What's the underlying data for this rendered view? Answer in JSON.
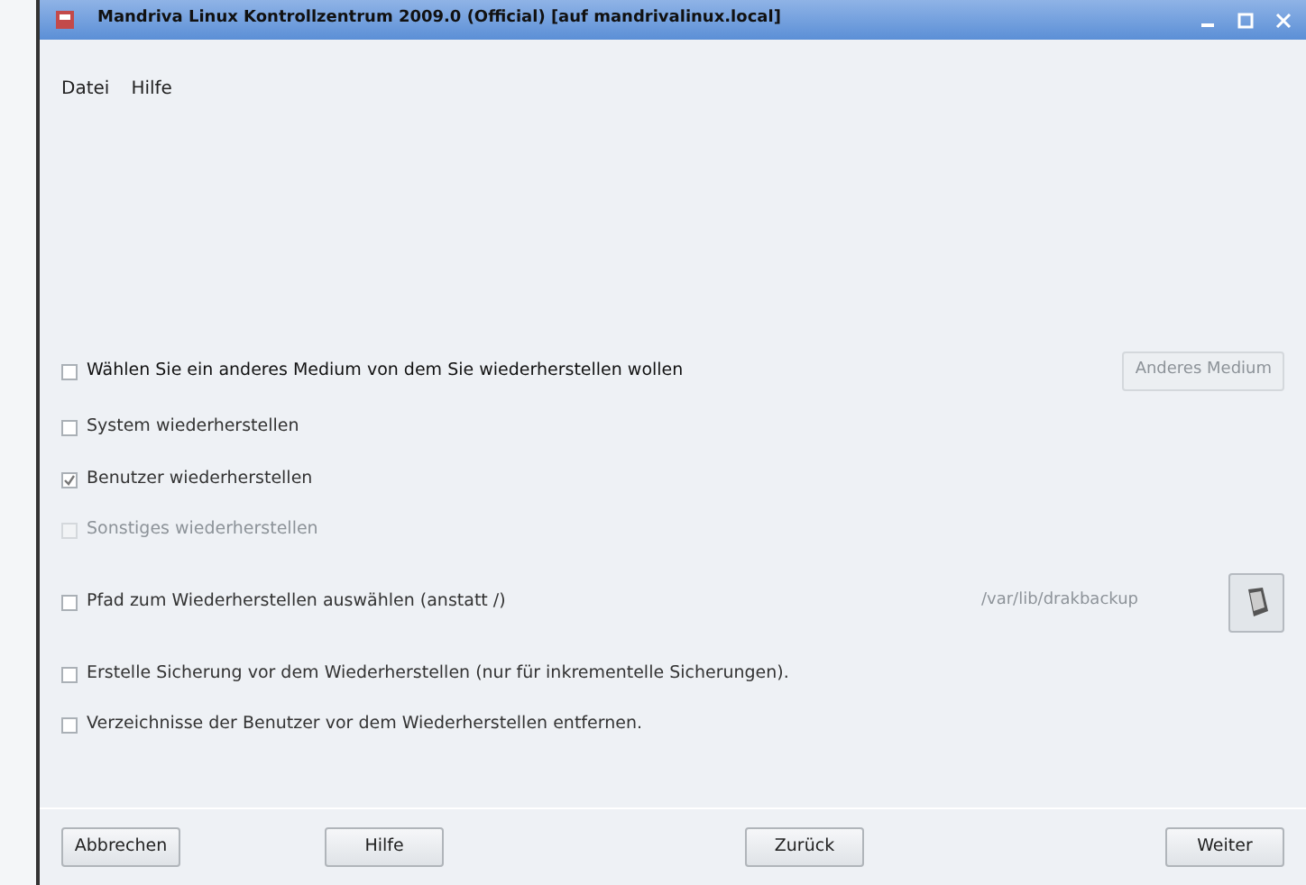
{
  "window": {
    "title": "Mandriva Linux Kontrollzentrum 2009.0 (Official) [auf mandrivalinux.local]"
  },
  "menu": [
    "Datei",
    "Hilfe"
  ],
  "options": [
    {
      "kind": "with_button",
      "label": "Wählen Sie ein anderes Medium von dem Sie wiederherstellen wollen",
      "checked": false,
      "disabled": false,
      "button": {
        "label": "Anderes Medium",
        "disabled": true
      }
    },
    {
      "kind": "plain",
      "label": "System wiederherstellen",
      "checked": false,
      "disabled": false
    },
    {
      "kind": "plain",
      "label": "Benutzer wiederherstellen",
      "checked": true,
      "disabled": false
    },
    {
      "kind": "plain",
      "label": "Sonstiges wiederherstellen",
      "checked": false,
      "disabled": true
    },
    {
      "kind": "with_path",
      "label": "Pfad zum Wiederherstellen auswählen (anstatt /)",
      "checked": false,
      "disabled": false,
      "path": "/var/lib/drakbackup"
    },
    {
      "kind": "plain",
      "label": "Erstelle Sicherung vor dem Wiederherstellen (nur für inkrementelle Sicherungen).",
      "checked": false,
      "disabled": false
    },
    {
      "kind": "plain",
      "label": "Verzeichnisse der Benutzer vor dem Wiederherstellen entfernen.",
      "checked": false,
      "disabled": false
    }
  ],
  "buttons": [
    "Abbrechen",
    "Hilfe",
    "Zurück",
    "Weiter"
  ]
}
